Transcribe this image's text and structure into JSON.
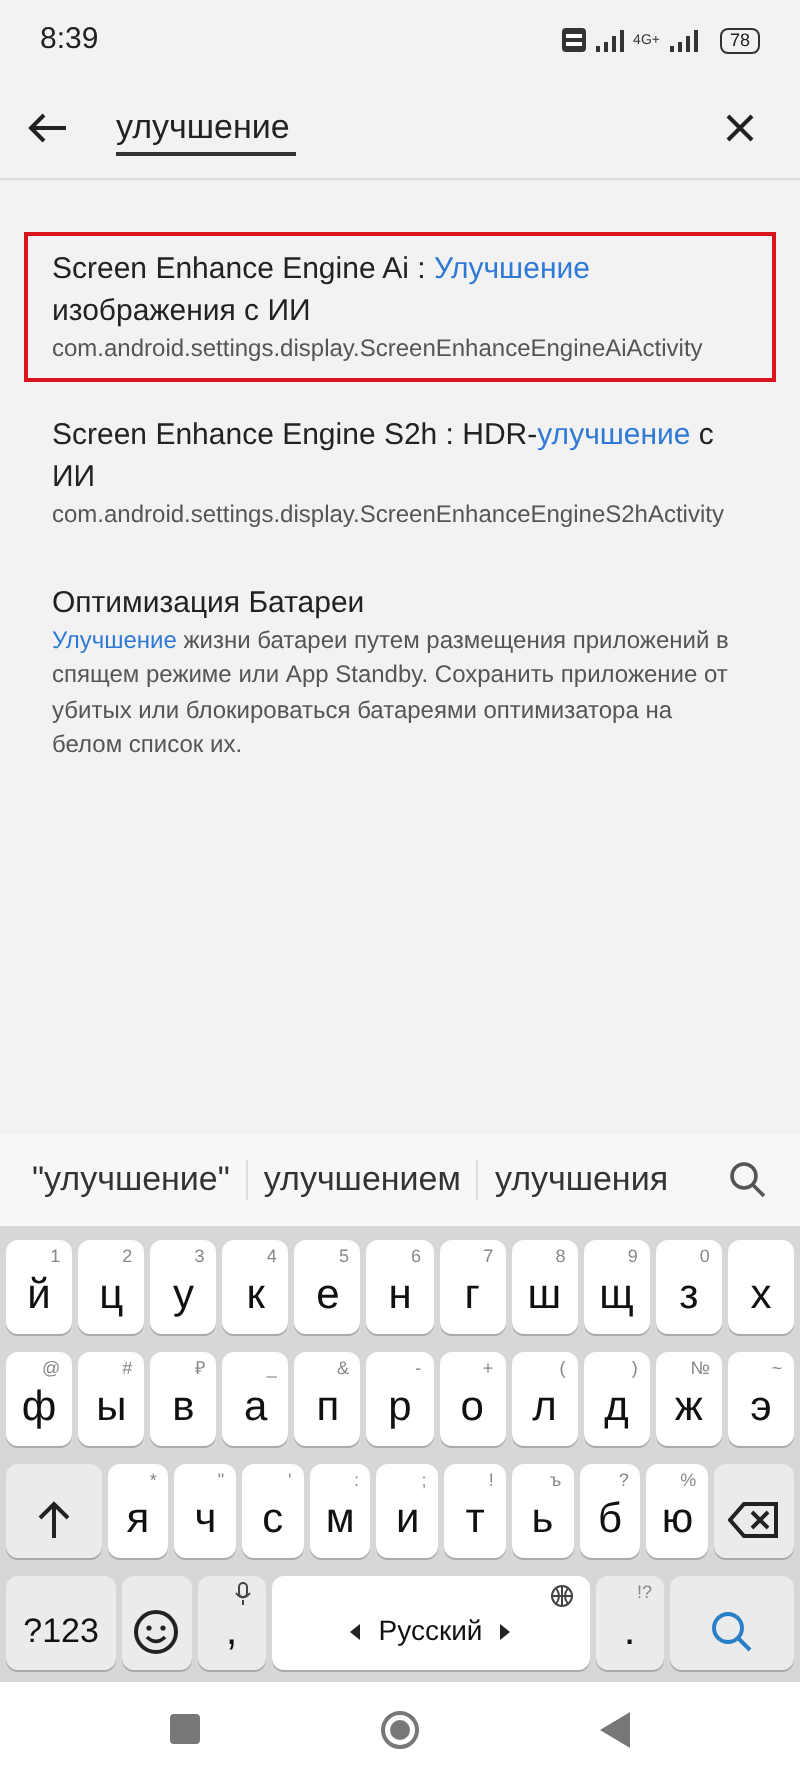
{
  "status_bar": {
    "time": "8:39",
    "network": "4G+",
    "battery": "78"
  },
  "search": {
    "value": "улучшение"
  },
  "results": [
    {
      "title": [
        {
          "text": "Screen Enhance Engine Ai : ",
          "match": false
        },
        {
          "text": "Улучшение",
          "match": true
        },
        {
          "text": " изображения с ИИ",
          "match": false
        }
      ],
      "subtitle": [
        {
          "text": "com.android.settings.display.ScreenEnhanceEngineAiActivity",
          "match": false
        }
      ],
      "highlighted": true
    },
    {
      "title": [
        {
          "text": "Screen Enhance Engine S2h : HDR-",
          "match": false
        },
        {
          "text": "улучшение",
          "match": true
        },
        {
          "text": " с ИИ",
          "match": false
        }
      ],
      "subtitle": [
        {
          "text": "com.android.settings.display.ScreenEnhanceEngineS2hActivity",
          "match": false
        }
      ],
      "highlighted": false
    },
    {
      "title": [
        {
          "text": "Оптимизация Батареи",
          "match": false
        }
      ],
      "subtitle": [
        {
          "text": "Улучшение",
          "match": true
        },
        {
          "text": " жизни батареи путем размещения приложений в спящем режиме или App Standby. Сохранить приложение от убитых или блокироваться батареями оптимизатора на белом список их.",
          "match": false
        }
      ],
      "highlighted": false
    }
  ],
  "suggestions": [
    "\"улучшение\"",
    "улучшением",
    "улучшения"
  ],
  "keyboard": {
    "rows": [
      {
        "keys": [
          {
            "kind": "letter",
            "label": "й",
            "hint": "1"
          },
          {
            "kind": "letter",
            "label": "ц",
            "hint": "2"
          },
          {
            "kind": "letter",
            "label": "у",
            "hint": "3"
          },
          {
            "kind": "letter",
            "label": "к",
            "hint": "4"
          },
          {
            "kind": "letter",
            "label": "е",
            "hint": "5"
          },
          {
            "kind": "letter",
            "label": "н",
            "hint": "6"
          },
          {
            "kind": "letter",
            "label": "г",
            "hint": "7"
          },
          {
            "kind": "letter",
            "label": "ш",
            "hint": "8"
          },
          {
            "kind": "letter",
            "label": "щ",
            "hint": "9"
          },
          {
            "kind": "letter",
            "label": "з",
            "hint": "0"
          },
          {
            "kind": "letter",
            "label": "х"
          }
        ]
      },
      {
        "keys": [
          {
            "kind": "letter",
            "label": "ф",
            "hint": "@"
          },
          {
            "kind": "letter",
            "label": "ы",
            "hint": "#"
          },
          {
            "kind": "letter",
            "label": "в",
            "hint": "₽"
          },
          {
            "kind": "letter",
            "label": "а",
            "hint": "_"
          },
          {
            "kind": "letter",
            "label": "п",
            "hint": "&"
          },
          {
            "kind": "letter",
            "label": "р",
            "hint": "-"
          },
          {
            "kind": "letter",
            "label": "о",
            "hint": "+"
          },
          {
            "kind": "letter",
            "label": "л",
            "hint": "("
          },
          {
            "kind": "letter",
            "label": "д",
            "hint": ")"
          },
          {
            "kind": "letter",
            "label": "ж",
            "hint": "№"
          },
          {
            "kind": "letter",
            "label": "э",
            "hint": "~"
          }
        ]
      },
      {
        "keys": [
          {
            "kind": "shift"
          },
          {
            "kind": "letter",
            "label": "я",
            "hint": "*"
          },
          {
            "kind": "letter",
            "label": "ч",
            "hint": "\""
          },
          {
            "kind": "letter",
            "label": "с",
            "hint": "'"
          },
          {
            "kind": "letter",
            "label": "м",
            "hint": ":"
          },
          {
            "kind": "letter",
            "label": "и",
            "hint": ";"
          },
          {
            "kind": "letter",
            "label": "т",
            "hint": "!"
          },
          {
            "kind": "letter",
            "label": "ь",
            "hint": "ъ"
          },
          {
            "kind": "letter",
            "label": "б",
            "hint": "?"
          },
          {
            "kind": "letter",
            "label": "ю",
            "hint": "%"
          },
          {
            "kind": "backspace"
          }
        ]
      },
      {
        "keys": [
          {
            "kind": "symbols",
            "label": "?123"
          },
          {
            "kind": "emoji"
          },
          {
            "kind": "comma",
            "label": ","
          },
          {
            "kind": "space",
            "label": "Русский"
          },
          {
            "kind": "period",
            "label": ".",
            "hint": "!?"
          },
          {
            "kind": "action"
          }
        ]
      }
    ]
  }
}
